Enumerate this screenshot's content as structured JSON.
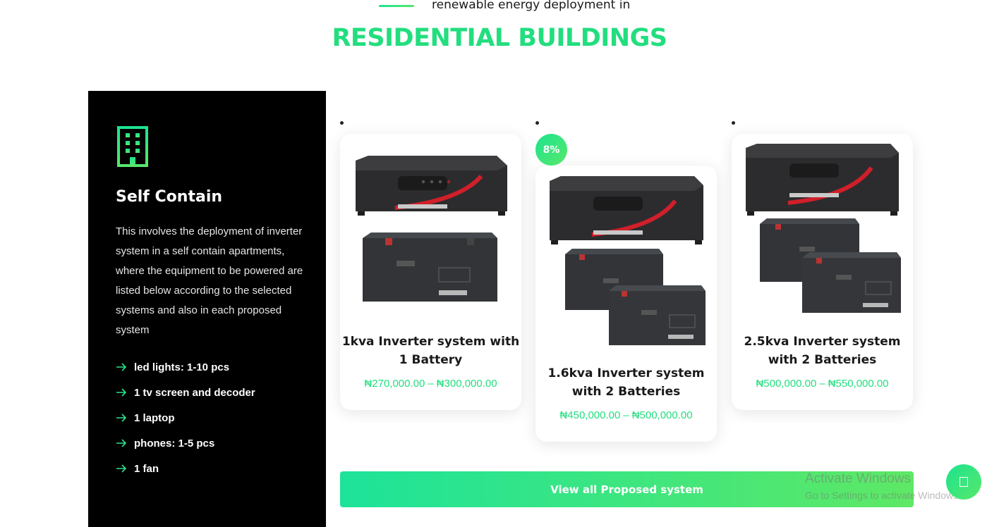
{
  "header": {
    "top_text": "renewable energy deployment in",
    "title": "RESIDENTIAL BUILDINGS"
  },
  "panel": {
    "icon": "building-icon",
    "title": "Self Contain",
    "description": "This involves the deployment of inverter system in a self contain apartments, where the equipment to be powered are listed below according to the selected systems and also in each proposed system",
    "features": [
      "led lights: 1-10 pcs",
      "1 tv screen and decoder",
      "1 laptop",
      "phones: 1-5 pcs",
      "1 fan"
    ]
  },
  "products": [
    {
      "title": "1kva Inverter system with 1 Battery",
      "price_low": "₦270,000.00",
      "price_high": "₦300,000.00",
      "separator": "–",
      "image": "inverter-1-battery"
    },
    {
      "title": "1.6kva Inverter system with 2 Batteries",
      "price_low": "₦450,000.00",
      "price_high": "₦500,000.00",
      "separator": "–",
      "badge": "8%",
      "image": "inverter-2-batteries"
    },
    {
      "title": "2.5kva Inverter system with 2 Batteries",
      "price_low": "₦500,000.00",
      "price_high": "₦550,000.00",
      "separator": "–",
      "image": "inverter-2-batteries"
    }
  ],
  "cta": {
    "label": "View all Proposed system"
  },
  "watermark": {
    "title": "Activate Windows",
    "subtitle": "Go to Settings to activate Windows."
  },
  "colors": {
    "accent": "#22de7e",
    "accent_end": "#57e86b",
    "panel_bg": "#000000"
  }
}
